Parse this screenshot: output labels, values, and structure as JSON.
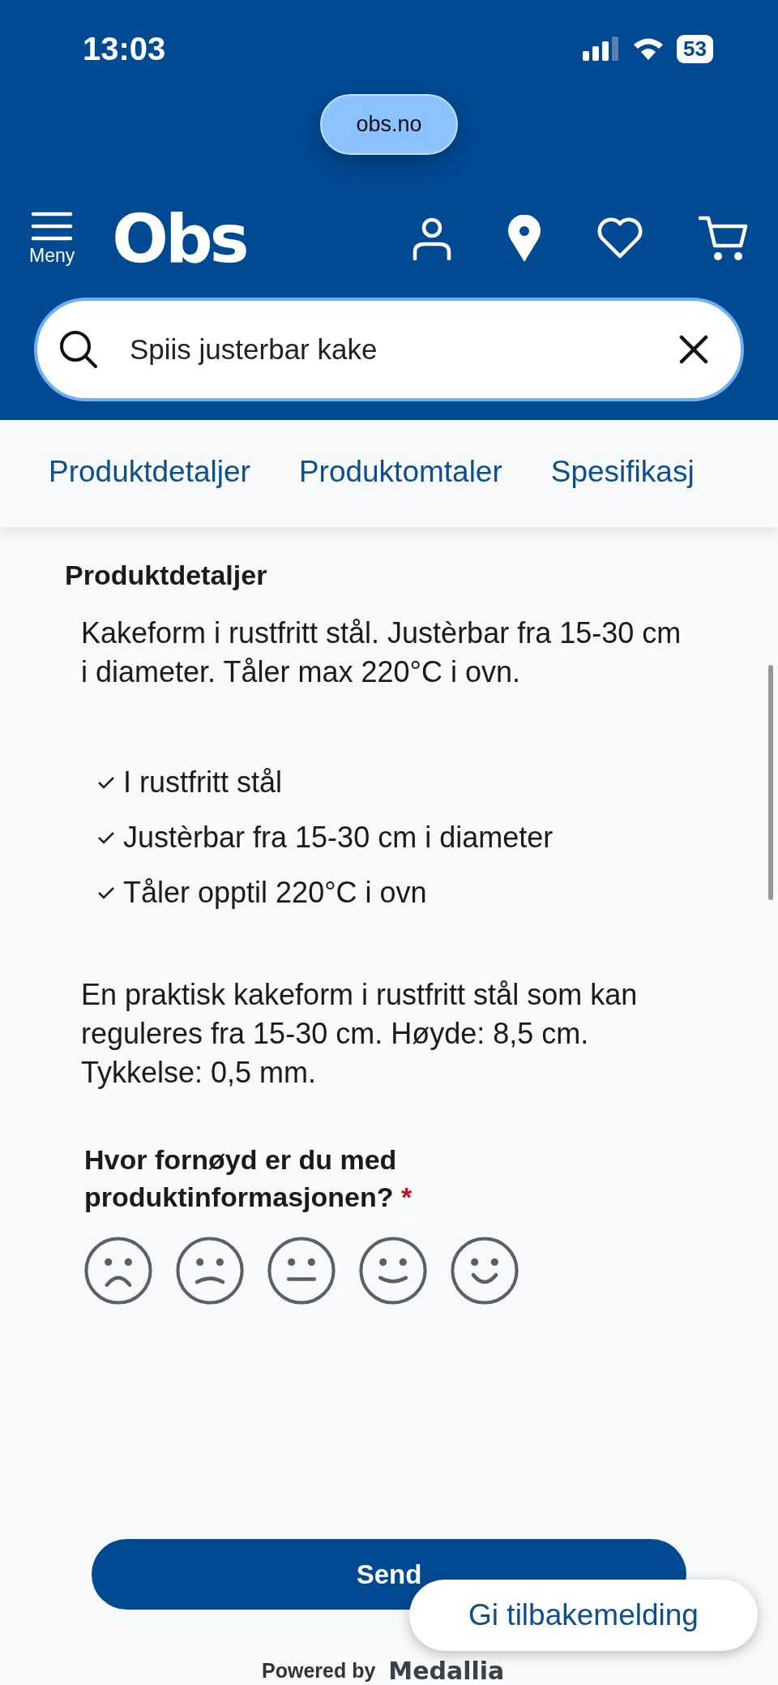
{
  "status_bar": {
    "time": "13:03",
    "battery": "53"
  },
  "address_bar": {
    "url": "obs.no"
  },
  "header": {
    "menu_label": "Meny",
    "logo": "Obs"
  },
  "search": {
    "value": "Spiis justerbar kake"
  },
  "tabs": [
    {
      "label": "Produktdetaljer",
      "selected": false
    },
    {
      "label": "Produktomtaler",
      "selected": false
    },
    {
      "label": "Spesifikasj",
      "selected": false
    }
  ],
  "details": {
    "title": "Produktdetaljer",
    "intro": "Kakeform i rustfritt stål. Justèrbar fra 15-30 cm i diameter. Tåler max 220°C i ovn.",
    "features": [
      "I rustfritt stål",
      "Justèrbar fra 15-30 cm i diameter",
      "Tåler opptil 220°C i ovn"
    ],
    "description": "En praktisk kakeform i rustfritt stål som kan reguleres fra 15-30 cm. Høyde: 8,5 cm. Tykkelse: 0,5 mm."
  },
  "survey": {
    "question": "Hvor fornøyd er du med produktinformasjonen?",
    "required_mark": "*",
    "ratings": [
      {
        "kind": "very-sad",
        "selected": false
      },
      {
        "kind": "sad",
        "selected": false
      },
      {
        "kind": "neutral",
        "selected": false
      },
      {
        "kind": "happy",
        "selected": false
      },
      {
        "kind": "very-happy",
        "selected": false
      }
    ],
    "submit": "Send",
    "powered_by": "Powered by",
    "provider": "Medallia"
  },
  "feedback_button": "Gi tilbakemelding"
}
